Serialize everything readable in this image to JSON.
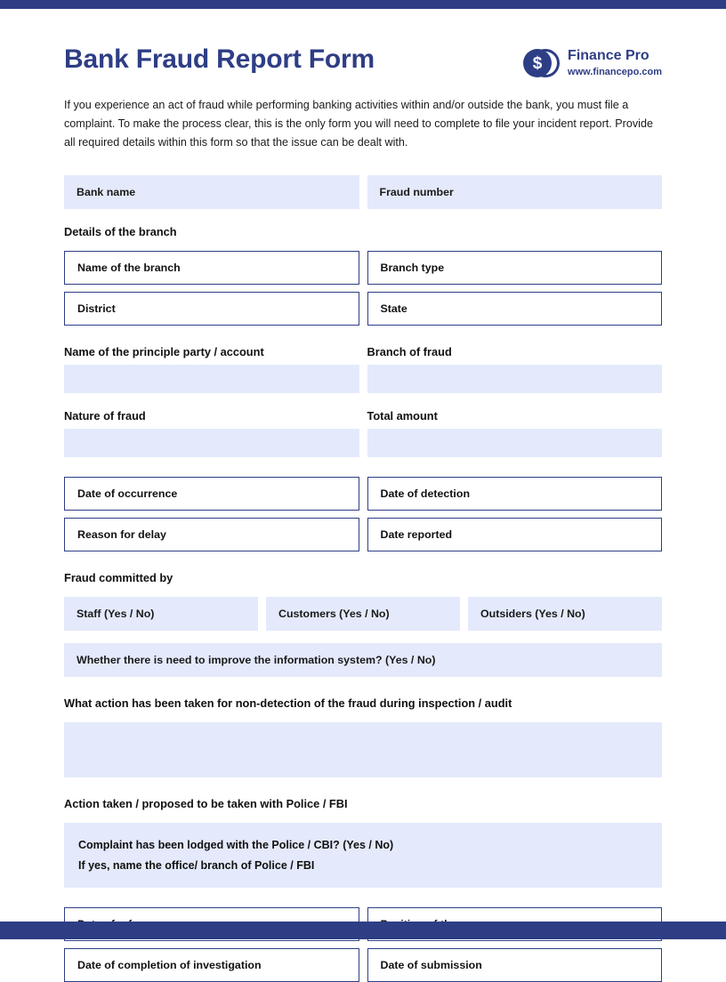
{
  "theme": {
    "navy": "#2e3e85",
    "field_fill": "#e4eafb",
    "text": "#1a1a1a"
  },
  "header": {
    "title": "Bank Fraud Report Form",
    "brand_name": "Finance Pro",
    "brand_url": "www.financepo.com",
    "logo_symbol": "$"
  },
  "intro": "If you experience an act of fraud while performing banking activities within and/or outside the bank, you must file a complaint. To make the process clear, this is the only form you will need to complete to file your incident report. Provide all required details within this form so that the issue can be dealt with.",
  "top_row": {
    "bank_name": "Bank name",
    "fraud_number": "Fraud number"
  },
  "branch_section": {
    "heading": "Details of the branch",
    "name_of_branch": "Name of the branch",
    "branch_type": "Branch type",
    "district": "District",
    "state": "State"
  },
  "party_section": {
    "principle_party": "Name of the principle party / account",
    "branch_of_fraud": "Branch of fraud",
    "nature_of_fraud": "Nature of fraud",
    "total_amount": "Total amount",
    "principle_party_value": "",
    "branch_of_fraud_value": "",
    "nature_of_fraud_value": "",
    "total_amount_value": ""
  },
  "dates_section": {
    "date_of_occurrence": "Date of occurrence",
    "date_of_detection": "Date of detection",
    "reason_for_delay": "Reason for delay",
    "date_reported": "Date reported"
  },
  "committed_by": {
    "heading": "Fraud committed by",
    "staff": "Staff (Yes / No)",
    "customers": "Customers (Yes / No)",
    "outsiders": "Outsiders (Yes / No)"
  },
  "improve_system": {
    "question": "Whether there is need to improve the information system? (Yes / No)"
  },
  "non_detection": {
    "heading": "What action has been taken for non-detection of the fraud during inspection / audit",
    "value": ""
  },
  "police_section": {
    "heading": "Action taken / proposed to be taken with Police / FBI",
    "line1": "Complaint has been lodged with the Police / CBI? (Yes / No)",
    "line2": "If yes, name the office/ branch of Police / FBI"
  },
  "closing_section": {
    "date_of_reference": "Date of reference",
    "position_of_case": "Position of the case",
    "date_of_completion": "Date of completion of investigation",
    "date_of_submission": "Date of submission"
  }
}
